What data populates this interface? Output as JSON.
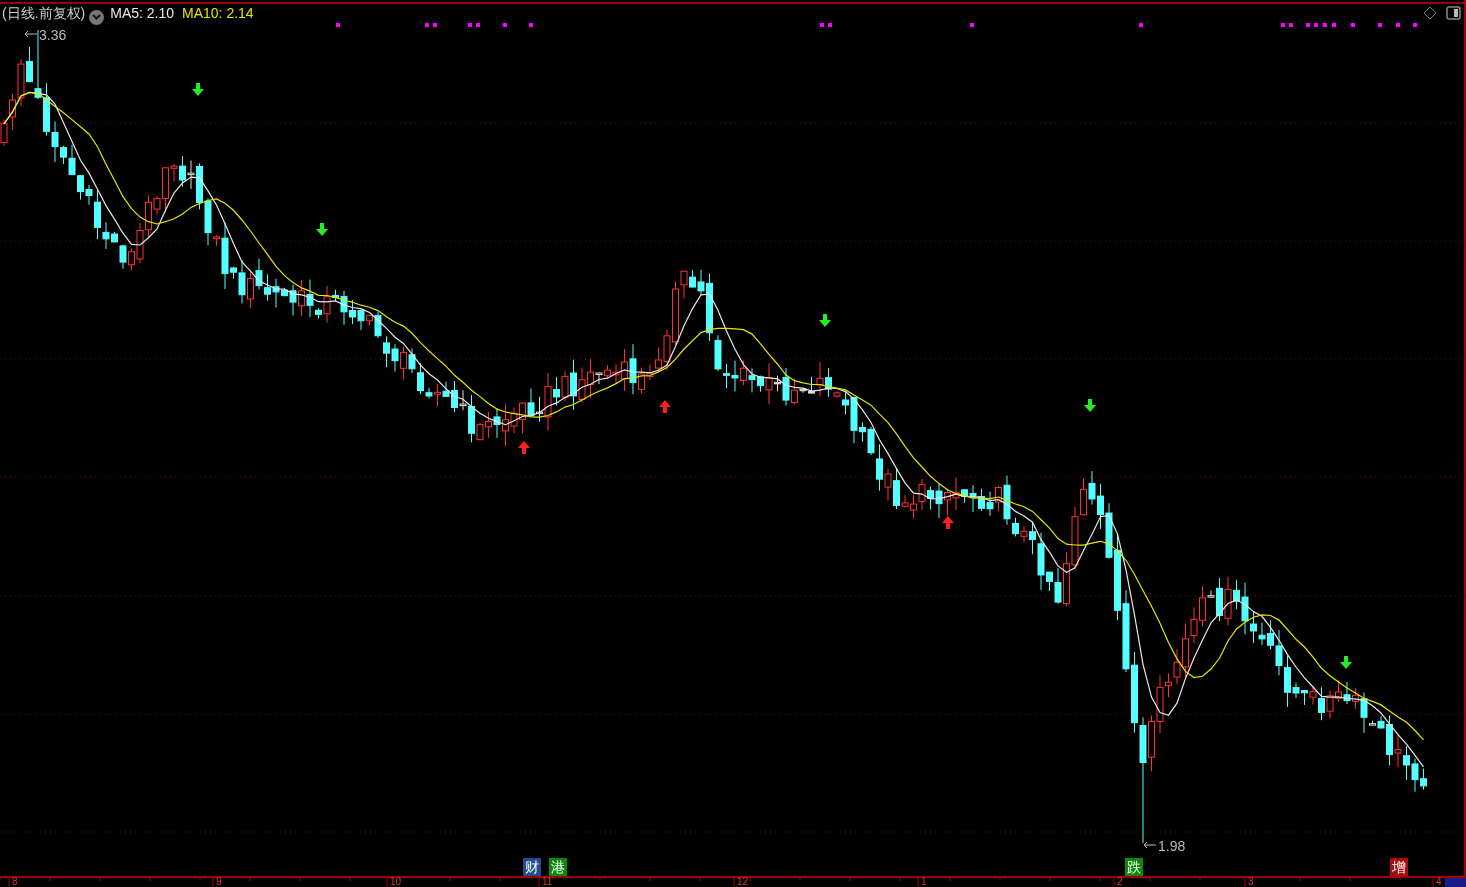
{
  "header": {
    "period": "(日线.前复权)",
    "indicators": [
      {
        "label": "MA5: 2.10",
        "color": "#e8e8e8"
      },
      {
        "label": "MA10: 2.14",
        "color": "#e6e600"
      }
    ]
  },
  "chart": {
    "high_label": "3.36",
    "low_label": "1.98"
  },
  "badges": [
    {
      "text": "财",
      "color": "#1e4e8c"
    },
    {
      "text": "港",
      "color": "#0a8a0a"
    },
    {
      "text": "跌",
      "color": "#0a8a0a"
    },
    {
      "text": "增",
      "color": "#a01010"
    }
  ],
  "x_axis": {
    "labels": [
      "8",
      "9",
      "10",
      "11",
      "12",
      "1",
      "2",
      "3",
      "4"
    ]
  }
}
